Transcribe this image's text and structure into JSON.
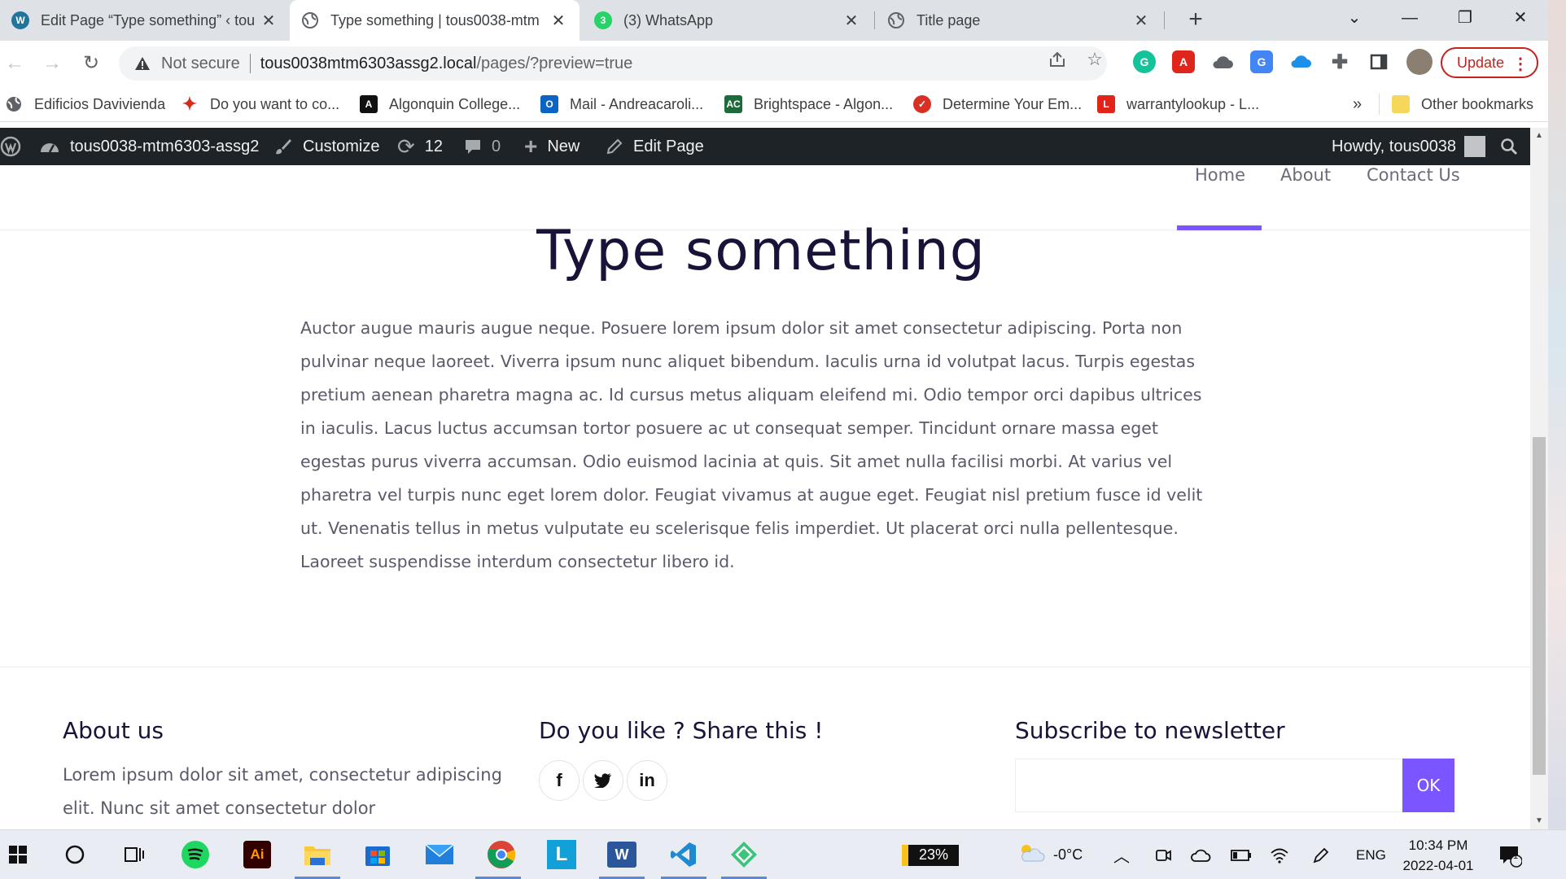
{
  "browser": {
    "tabs": [
      {
        "title": "Edit Page “Type something” ‹ tou",
        "favicon": "wordpress-icon",
        "active": false
      },
      {
        "title": "Type something | tous0038-mtm",
        "favicon": "globe-icon",
        "active": true
      },
      {
        "title": "(3) WhatsApp",
        "favicon": "whatsapp-icon",
        "badge": "3",
        "active": false
      },
      {
        "title": "Title page",
        "favicon": "globe-icon",
        "active": false
      }
    ],
    "tab_close_glyph": "✕",
    "new_tab_glyph": "+",
    "window_controls": {
      "tab_search": "⌄",
      "minimize": "—",
      "restore": "❐",
      "close": "✕"
    },
    "omnibox": {
      "security_label": "Not secure",
      "host": "tous0038mtm6303assg2.local",
      "path": "/pages/?preview=true"
    },
    "update_label": "Update"
  },
  "bookmarks": [
    {
      "label": "Edificios Davivienda",
      "icon": "globe-icon",
      "color": "#5f6368"
    },
    {
      "label": "Do you want to co...",
      "icon": "maple-leaf-icon",
      "color": "#d52b1e"
    },
    {
      "label": "Algonquin College...",
      "icon": "algonquin-icon",
      "color": "#111111"
    },
    {
      "label": "Mail - Andreacaroli...",
      "icon": "outlook-icon",
      "color": "#0a64c6"
    },
    {
      "label": "Brightspace - Algon...",
      "icon": "brightspace-icon",
      "color": "#1d6b3a"
    },
    {
      "label": "Determine Your Em...",
      "icon": "checkmark-icon",
      "color": "#d93025"
    },
    {
      "label": "warrantylookup - L...",
      "icon": "lenovo-icon",
      "color": "#e2231a"
    }
  ],
  "bookmarks_overflow": "»",
  "other_bookmarks": "Other bookmarks",
  "wp_admin": {
    "site_name": "tous0038-mtm6303-assg2",
    "customize": "Customize",
    "updates_count": "12",
    "comments_count": "0",
    "new_label": "New",
    "edit_page": "Edit Page",
    "howdy": "Howdy, tous0038"
  },
  "site": {
    "nav": [
      "Home",
      "About",
      "Contact Us"
    ],
    "active_nav": "Home",
    "accent": "#7b55ff",
    "title": "Type something",
    "body": "Auctor augue mauris augue neque. Posuere lorem ipsum dolor sit amet consectetur adipiscing. Porta non pulvinar neque laoreet. Viverra ipsum nunc aliquet bibendum. Iaculis urna id volutpat lacus. Turpis egestas pretium aenean pharetra magna ac. Id cursus metus aliquam eleifend mi. Odio tempor orci dapibus ultrices in iaculis. Lacus luctus accumsan tortor posuere ac ut consequat semper. Tincidunt ornare massa eget egestas purus viverra accumsan. Odio euismod lacinia at quis. Sit amet nulla facilisi morbi. At varius vel pharetra vel turpis nunc eget lorem dolor. Feugiat vivamus at augue eget. Feugiat nisl pretium fusce id velit ut. Venenatis tellus in metus vulputate eu scelerisque felis imperdiet. Ut placerat orci nulla pellentesque. Laoreet suspendisse interdum consectetur libero id.",
    "footer": {
      "about_heading": "About us",
      "about_text": "Lorem ipsum dolor sit amet, consectetur adipiscing elit. Nunc sit amet consectetur dolor",
      "share_heading": "Do you like ? Share this !",
      "social": [
        {
          "glyph": "f",
          "icon": "facebook-icon"
        },
        {
          "glyph": "𝕥",
          "icon": "twitter-icon"
        },
        {
          "glyph": "in",
          "icon": "linkedin-icon"
        }
      ],
      "newsletter_heading": "Subscribe to newsletter",
      "newsletter_button": "OK",
      "newsletter_placeholder": ""
    }
  },
  "taskbar": {
    "apps": [
      {
        "icon": "start-icon"
      },
      {
        "icon": "search-icon"
      },
      {
        "icon": "task-view-icon"
      },
      {
        "icon": "spotify-icon"
      },
      {
        "icon": "illustrator-icon",
        "glyph": "Ai"
      },
      {
        "icon": "file-explorer-icon"
      },
      {
        "icon": "microsoft-store-icon"
      },
      {
        "icon": "mail-icon"
      },
      {
        "icon": "chrome-icon"
      },
      {
        "icon": "l-app-icon",
        "glyph": "L"
      },
      {
        "icon": "word-icon",
        "glyph": "W"
      },
      {
        "icon": "vscode-icon"
      },
      {
        "icon": "green-app-icon"
      }
    ],
    "battery_percent": "23%",
    "weather": "-0°C",
    "language": "ENG",
    "time": "10:34 PM",
    "date": "2022-04-01",
    "notification_count": "1"
  }
}
